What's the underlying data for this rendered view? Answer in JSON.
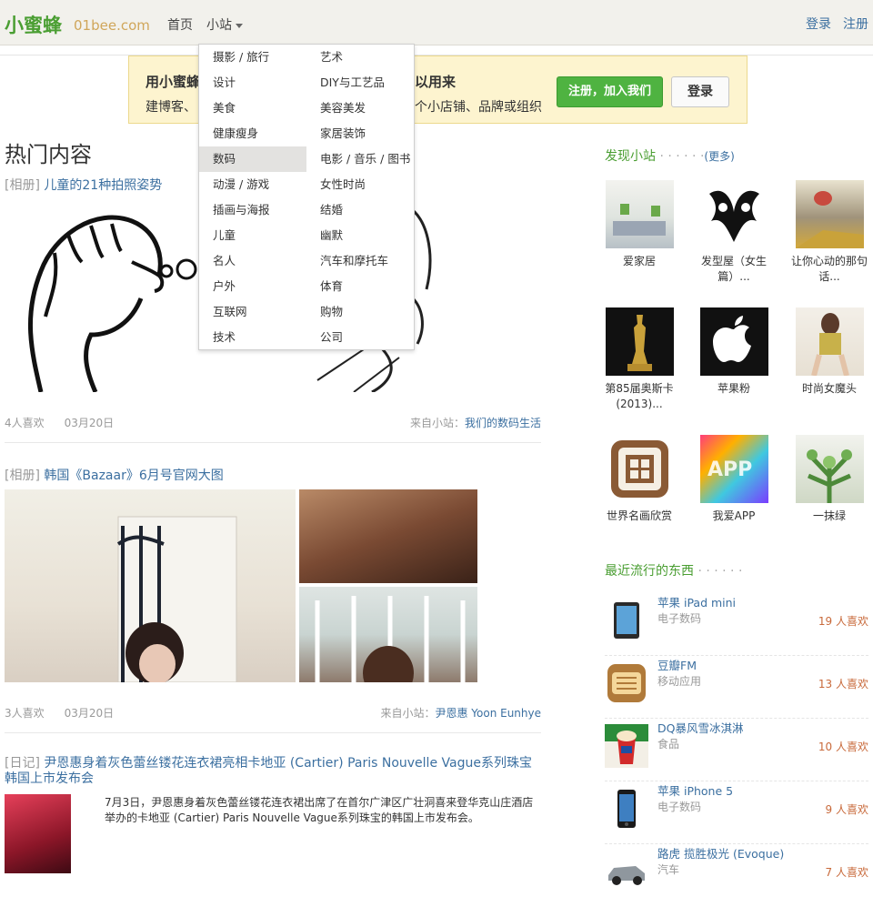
{
  "header": {
    "logo": "小蜜蜂",
    "domain": "01bee.com",
    "nav_home": "首页",
    "nav_sites": "小站",
    "login": "登录",
    "register": "注册"
  },
  "banner": {
    "title_left": "用小蜜蜂",
    "title_right": "以用来",
    "sub_left": "建博客、",
    "sub_right": "个小店铺、品牌或组织",
    "join_button": "注册，加入我们",
    "login_button": "登录"
  },
  "dropdown": {
    "left": [
      "摄影 / 旅行",
      "设计",
      "美食",
      "健康瘦身",
      "数码",
      "动漫 / 游戏",
      "插画与海报",
      "儿童",
      "名人",
      "户外",
      "互联网",
      "技术"
    ],
    "right": [
      "艺术",
      "DIY与工艺品",
      "美容美发",
      "家居装饰",
      "电影 / 音乐 / 图书",
      "女性时尚",
      "结婚",
      "幽默",
      "汽车和摩托车",
      "体育",
      "购物",
      "公司"
    ],
    "active": "数码"
  },
  "main": {
    "section_title": "热门内容",
    "posts": [
      {
        "tag": "[相册]",
        "title": "儿童的21种拍照姿势",
        "likes": "4人喜欢",
        "date": "03月20日",
        "source_label": "来自小站：",
        "source": "我们的数码生活"
      },
      {
        "tag": "[相册]",
        "title": "韩国《Bazaar》6月号官网大图",
        "likes": "3人喜欢",
        "date": "03月20日",
        "source_label": "来自小站：",
        "source": "尹恩惠 Yoon Eunhye"
      },
      {
        "tag": "[日记]",
        "title": "尹恩惠身着灰色蕾丝镂花连衣裙亮相卡地亚 (Cartier) Paris Nouvelle Vague系列珠宝韩国上市发布会",
        "body": "7月3日，尹恩惠身着灰色蕾丝镂花连衣裙出席了在首尔广津区广壮洞喜来登华克山庄酒店举办的卡地亚 (Cartier) Paris Nouvelle Vague系列珠宝的韩国上市发布会。"
      }
    ]
  },
  "sidebar": {
    "discover_heading": "发现小站",
    "discover_dots": "· · · · · ·",
    "discover_more": "(更多)",
    "sites": [
      {
        "name": "爱家居"
      },
      {
        "name": "发型屋（女生篇）..."
      },
      {
        "name": "让你心动的那句话..."
      },
      {
        "name": "第85届奥斯卡(2013)..."
      },
      {
        "name": "苹果粉"
      },
      {
        "name": "时尚女魔头"
      },
      {
        "name": "世界名画欣赏"
      },
      {
        "name": "我爱APP"
      },
      {
        "name": "一抹绿"
      }
    ],
    "trending_heading": "最近流行的东西",
    "trending_dots": "· · · · · ·",
    "trending": [
      {
        "name": "苹果 iPad mini",
        "category": "电子数码",
        "likes": "19 人喜欢"
      },
      {
        "name": "豆瓣FM",
        "category": "移动应用",
        "likes": "13 人喜欢"
      },
      {
        "name": "DQ暴风雪冰淇淋",
        "category": "食品",
        "likes": "10 人喜欢"
      },
      {
        "name": "苹果 iPhone 5",
        "category": "电子数码",
        "likes": "9 人喜欢"
      },
      {
        "name": "路虎 揽胜极光 (Evoque)",
        "category": "汽车",
        "likes": "7 人喜欢"
      }
    ]
  }
}
